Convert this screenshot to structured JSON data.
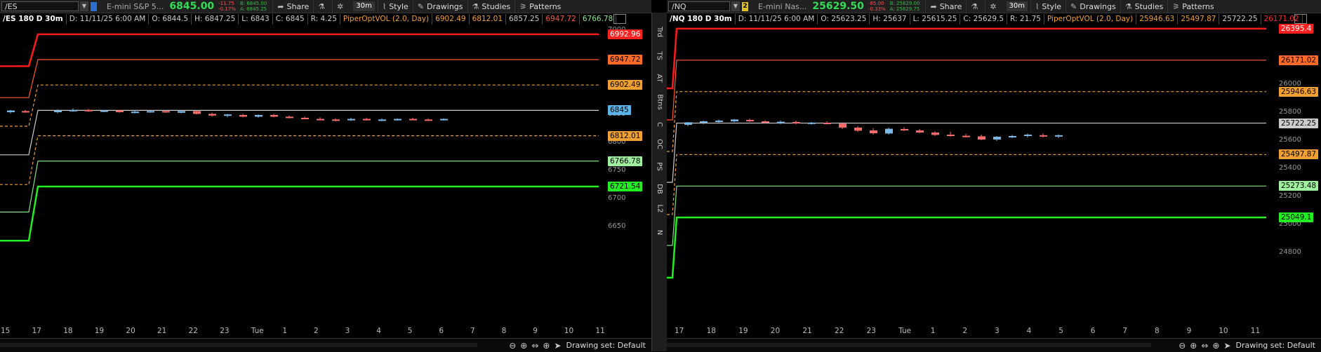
{
  "left": {
    "symbol": "/ES",
    "link_number": "",
    "description": "E-mini S&P 5...",
    "last": "6845.00",
    "change": "-11.75",
    "change_pct": "-0.17%",
    "bid": "B: 6845.00",
    "ask": "A: 6845.25",
    "timeframe": "30m",
    "info": {
      "symbol": "/ES 180 D 30m",
      "date": "D: 11/11/25 6:00 AM",
      "open": "O: 6844.5",
      "high": "H: 6847.25",
      "low": "L: 6843",
      "close": "C: 6845",
      "range": "R: 4.25",
      "study": "PiperOptVOL (2.0, Day)",
      "v1": "6902.49",
      "v2": "6812.01",
      "v3": "6857.25",
      "v4": "6947.72",
      "v5": "6766.78"
    },
    "y_axis": [
      "7000",
      "6950",
      "6900",
      "6850",
      "6800",
      "6750",
      "6700",
      "6650"
    ],
    "x_axis": [
      "15",
      "17",
      "18",
      "19",
      "20",
      "21",
      "22",
      "23",
      "Tue",
      "1",
      "2",
      "3",
      "4",
      "5",
      "6",
      "7",
      "8",
      "9",
      "10",
      "11"
    ],
    "price_tags": {
      "red_high": "6992.96",
      "orange_high": "6947.72",
      "dash_high": "6902.49",
      "last": "6845",
      "dash_low": "6812.01",
      "green_low": "6766.78",
      "bright_green": "6721.54"
    }
  },
  "right": {
    "symbol": "/NQ",
    "link_number": "2",
    "description": "E-mini Nas...",
    "last": "25629.50",
    "change": "-85.00",
    "change_pct": "-0.33%",
    "bid": "B: 25629.00",
    "ask": "A: 25629.75",
    "timeframe": "30m",
    "info": {
      "symbol": "/NQ 180 D 30m",
      "date": "D: 11/11/25 6:00 AM",
      "open": "O: 25623.25",
      "high": "H: 25637",
      "low": "L: 25615.25",
      "close": "C: 25629.5",
      "range": "R: 21.75",
      "study": "PiperOptVOL (2.0, Day)",
      "v1": "25946.63",
      "v2": "25497.87",
      "v3": "25722.25",
      "v6": "26171.02"
    },
    "y_axis": [
      "26000",
      "25800",
      "25600",
      "25400",
      "25200",
      "25000",
      "24800"
    ],
    "x_axis": [
      "17",
      "18",
      "19",
      "20",
      "21",
      "22",
      "23",
      "Tue",
      "1",
      "2",
      "3",
      "4",
      "5",
      "6",
      "7",
      "8",
      "9",
      "10",
      "11"
    ],
    "price_tags": {
      "red_high": "26395.4",
      "orange_high": "26171.02",
      "dash_high": "25946.63",
      "mid": "25722.25",
      "last": "25629.5",
      "dash_low": "25497.87",
      "green_low": "25273.48",
      "bright_green": "25049.1"
    }
  },
  "toolbar": {
    "share": "Share",
    "style": "Style",
    "drawings": "Drawings",
    "studies": "Studies",
    "patterns": "Patterns"
  },
  "sidebar_tabs": [
    "Trd",
    "TS",
    "AT",
    "Btns",
    "C",
    "OC",
    "PS",
    "DB",
    "L2",
    "N"
  ],
  "bottom": {
    "drawing_set": "Drawing set: Default"
  },
  "colors": {
    "red": "#ff1a1a",
    "orange": "#ff5a28",
    "dash": "#f0a030",
    "white": "#cccccc",
    "green": "#7fe07f",
    "bright_green": "#22ee22",
    "candle_up": "#7ab8e8",
    "candle_down": "#ff6a6a"
  }
}
